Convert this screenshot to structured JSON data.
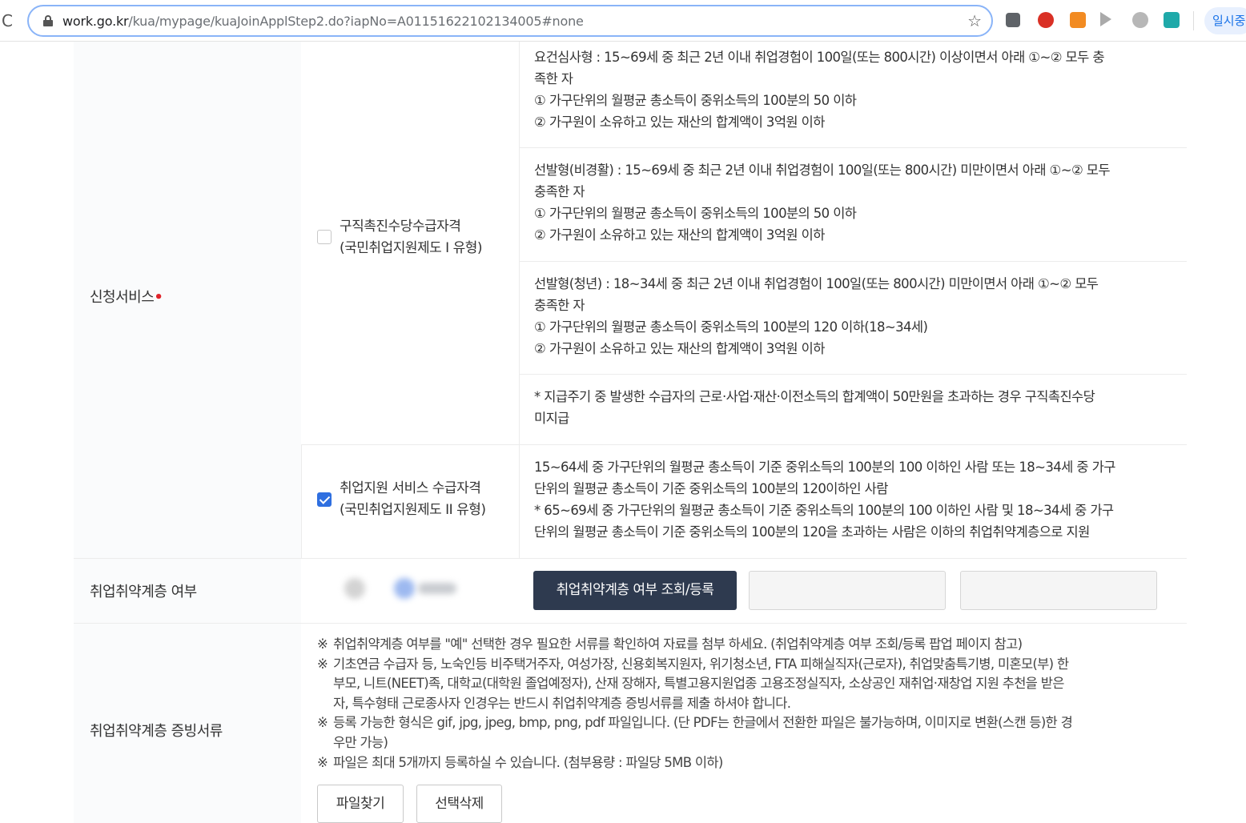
{
  "browser": {
    "url_domain": "work.go.kr",
    "url_path": "/kua/mypage/kuaJoinApplStep2.do?iapNo=A01151622102134005#none",
    "pause_label": "일시중"
  },
  "form": {
    "service_label": "신청서비스",
    "required_mark": "•",
    "option1": {
      "line1": "구직촉진수당수급자격",
      "line2": "(국민취업지원제도 I 유형)",
      "checked": false,
      "criteria": [
        {
          "title": "요건심사형 : 15~69세 중 최근 2년 이내 취업경험이 100일(또는 800시간) 이상이면서 아래 ①~② 모두 충",
          "title_cont": "족한 자",
          "c1": "① 가구단위의 월평균 총소득이 중위소득의 100분의 50 이하",
          "c2": "② 가구원이 소유하고 있는 재산의 합계액이 3억원 이하"
        },
        {
          "title": "선발형(비경활) : 15~69세 중 최근 2년 이내 취업경험이 100일(또는 800시간) 미만이면서 아래 ①~② 모두",
          "title_cont": "충족한 자",
          "c1": "① 가구단위의 월평균 총소득이 중위소득의 100분의 50 이하",
          "c2": "② 가구원이 소유하고 있는 재산의 합계액이 3억원 이하"
        },
        {
          "title": "선발형(청년) : 18~34세 중 최근 2년 이내 취업경험이 100일(또는 800시간) 미만이면서 아래 ①~② 모두",
          "title_cont": "충족한 자",
          "c1": "① 가구단위의 월평균 총소득이 중위소득의 100분의 120 이하(18~34세)",
          "c2": "② 가구원이 소유하고 있는 재산의 합계액이 3억원 이하"
        }
      ],
      "note_line1": "* 지급주기 중 발생한 수급자의 근로·사업·재산·이전소득의 합계액이 50만원을 초과하는 경우 구직촉진수당",
      "note_line2": "미지급"
    },
    "option2": {
      "line1": "취업지원 서비스 수급자격",
      "line2": "(국민취업지원제도 II 유형)",
      "checked": true,
      "desc": [
        "15~64세 중 가구단위의 월평균 총소득이 기준 중위소득의 100분의 100 이하인 사람 또는 18~34세 중 가구",
        "단위의 월평균 총소득이 기준 중위소득의 100분의 120이하인 사람",
        "* 65~69세 중 가구단위의 월평균 총소득이 기준 중위소득의 100분의 100 이하인 사람 및 18~34세 중 가구",
        "단위의 월평균 총소득이 기준 중위소득의 100분의 120을 초과하는 사람은 이하의 취업취약계층으로 지원"
      ]
    },
    "vulnerable_label": "취업취약계층 여부",
    "vulnerable_button": "취업취약계층 여부 조회/등록",
    "docs_label": "취업취약계층 증빙서류",
    "notes": [
      {
        "mark": "※",
        "lines": [
          "취업취약계층 여부를 \"예\" 선택한 경우 필요한 서류를 확인하여 자료를 첨부 하세요. (취업취약계층 여부 조회/등록 팝업 페이지 참고)"
        ]
      },
      {
        "mark": "※",
        "lines": [
          "기초연금 수급자 등, 노숙인등 비주택거주자, 여성가장, 신용회복지원자, 위기청소년, FTA 피해실직자(근로자), 취업맞춤특기병, 미혼모(부) 한",
          "부모, 니트(NEET)족, 대학교(대학원 졸업예정자), 산재 장해자, 특별고용지원업종 고용조정실직자, 소상공인 재취업·재창업 지원 추천을 받은",
          "자, 특수형태 근로종사자 인경우는 반드시 취업취약계층 증빙서류를 제출 하셔야 합니다."
        ]
      },
      {
        "mark": "※",
        "lines": [
          "등록 가능한 형식은 gif, jpg, jpeg, bmp, png, pdf 파일입니다. (단 PDF는 한글에서 전환한 파일은 불가능하며, 이미지로 변환(스캔 등)한 경",
          "우만 가능)"
        ]
      },
      {
        "mark": "※",
        "lines": [
          "파일은 최대 5개까지 등록하실 수 있습니다. (첨부용량 : 파일당 5MB 이하)"
        ]
      }
    ],
    "find_file_button": "파일찾기",
    "delete_selected_button": "선택삭제"
  },
  "colors": {
    "dark_button": "#2e3a4f",
    "checkbox_checked": "#2f6fe0",
    "required": "#e0242b"
  }
}
